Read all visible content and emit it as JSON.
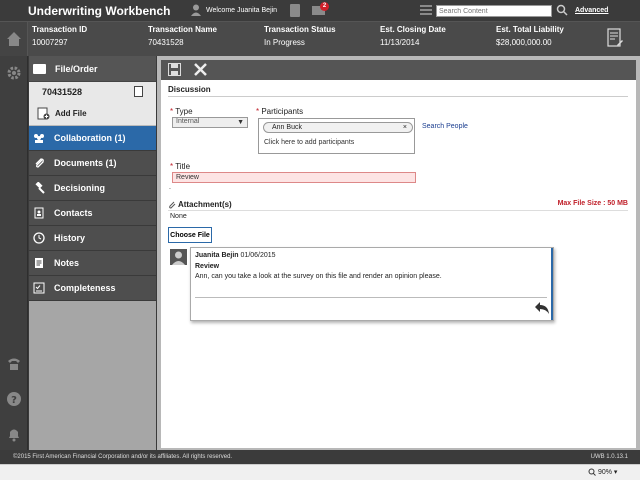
{
  "header": {
    "app_title": "Underwriting Workbench",
    "welcome": "Welcome Juanita Bejin",
    "mail_badge": "2",
    "search_placeholder": "Search Content",
    "advanced_label": "Advanced"
  },
  "transaction": {
    "columns": [
      {
        "label": "Transaction ID",
        "value": "10007297"
      },
      {
        "label": "Transaction Name",
        "value": "70431528"
      },
      {
        "label": "Transaction Status",
        "value": "In Progress"
      },
      {
        "label": "Est. Closing Date",
        "value": "11/13/2014"
      },
      {
        "label": "Est. Total Liability",
        "value": "$28,000,000.00"
      }
    ]
  },
  "sidebar": {
    "header": "File/Order",
    "order_number": "70431528",
    "add_file": "Add File",
    "items": [
      {
        "label": "Collaboration (1)",
        "icon": "collaboration-icon",
        "active": true
      },
      {
        "label": "Documents (1)",
        "icon": "paperclip-icon",
        "active": false
      },
      {
        "label": "Decisioning",
        "icon": "gavel-icon",
        "active": false
      },
      {
        "label": "Contacts",
        "icon": "contacts-icon",
        "active": false
      },
      {
        "label": "History",
        "icon": "clock-icon",
        "active": false
      },
      {
        "label": "Notes",
        "icon": "notes-icon",
        "active": false
      },
      {
        "label": "Completeness",
        "icon": "checklist-icon",
        "active": false
      }
    ]
  },
  "discussion": {
    "section_title": "Discussion",
    "type_label": "Type",
    "type_value": "Internal",
    "participants_label": "Participants",
    "participant_chip": "Ann Buck",
    "chip_remove": "×",
    "add_participants": "Click here to add participants",
    "search_people": "Search People",
    "title_label": "Title",
    "title_value": "Review",
    "dot": ".",
    "attachments_label": "Attachment(s)",
    "max_file_size": "Max File Size : 50 MB",
    "attachments_none": "None",
    "choose_file": "Choose File"
  },
  "comment": {
    "author": "Juanita Bejin",
    "date": "01/06/2015",
    "subject": "Review",
    "body": "Ann, can you take a look at the survey on this file and render an opinion please."
  },
  "footer": {
    "copyright": "©2015 First American Financial Corporation and/or its affiliates. All rights reserved.",
    "version": "UWB 1.0.13.1"
  },
  "statusbar": {
    "zoom": "90%"
  },
  "colors": {
    "accent": "#2b69a8",
    "required": "#c0202a",
    "toolbar": "#555555"
  }
}
